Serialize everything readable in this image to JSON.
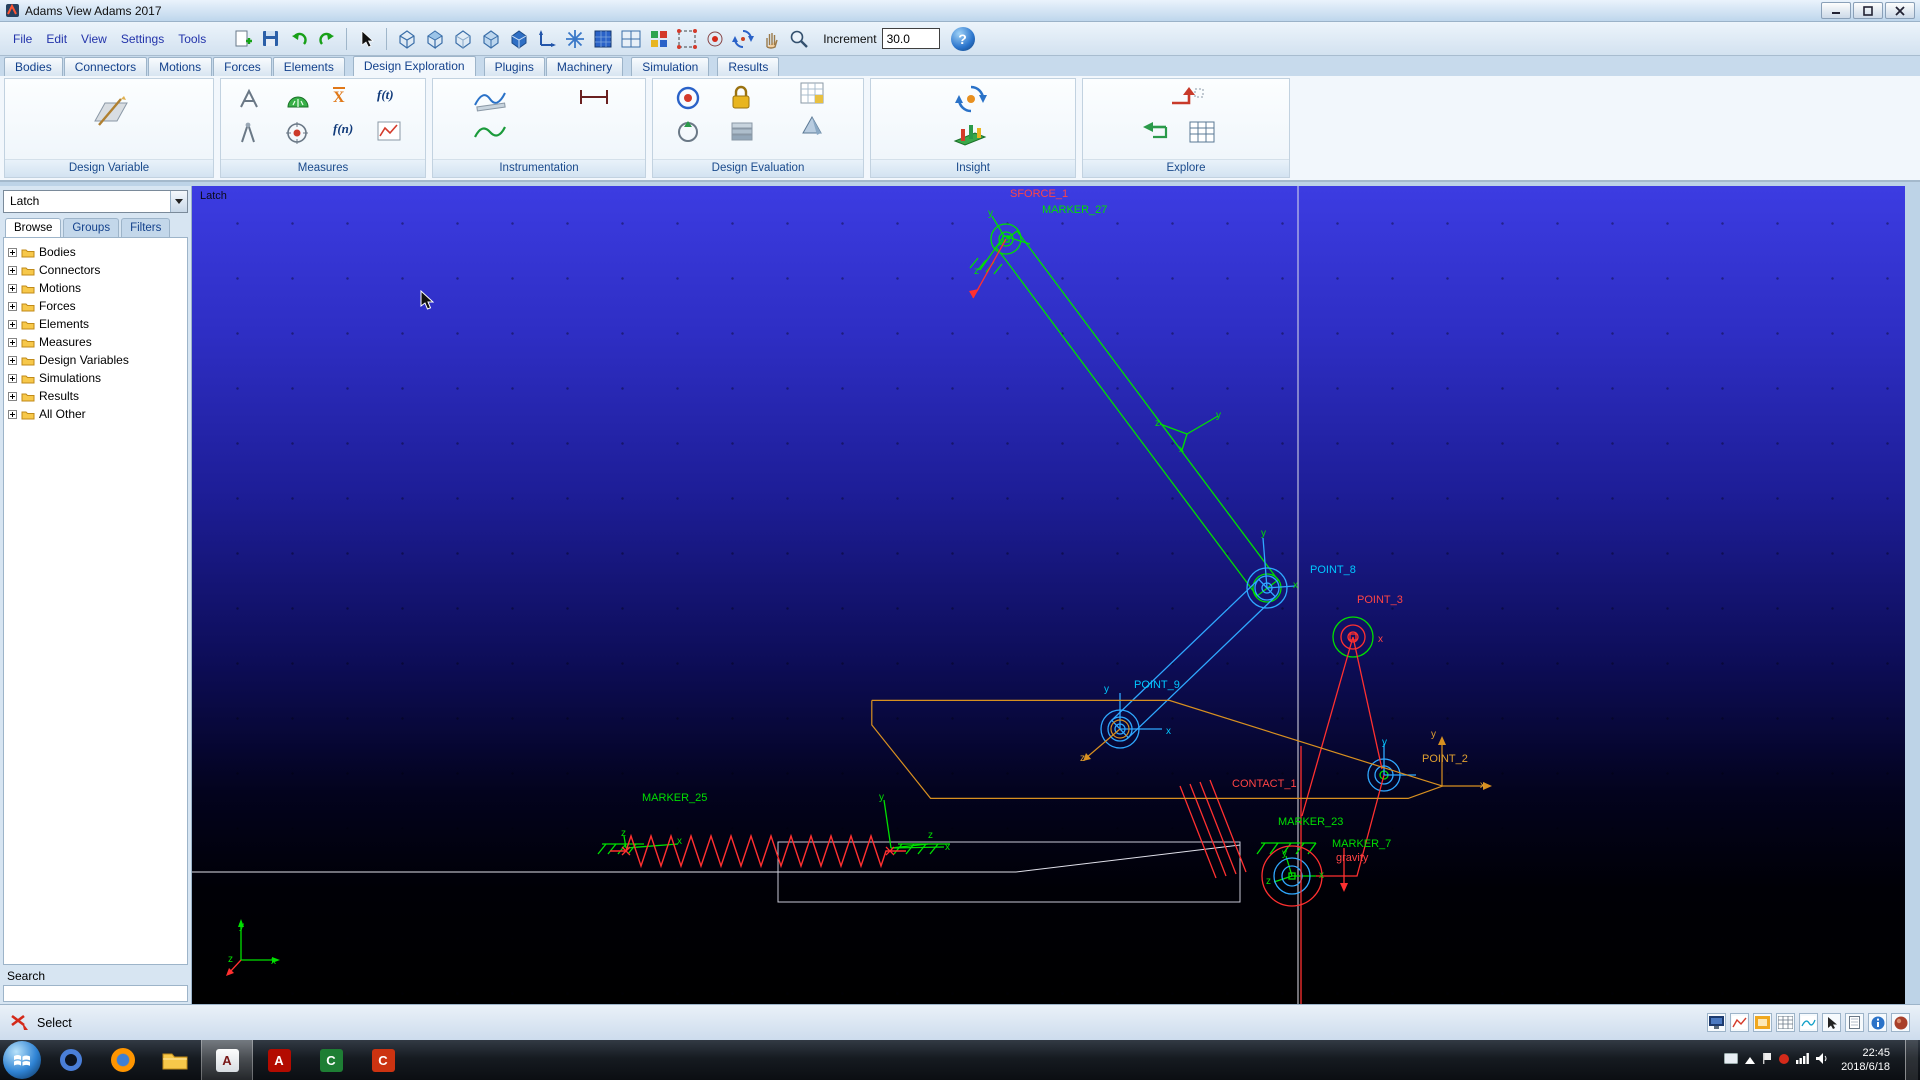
{
  "window": {
    "title": "Adams View Adams 2017"
  },
  "menubar": {
    "items": [
      "File",
      "Edit",
      "View",
      "Settings",
      "Tools"
    ]
  },
  "toolbar": {
    "increment_label": "Increment",
    "increment_value": "30.0",
    "help_glyph": "?"
  },
  "ribbon": {
    "tabs": [
      "Bodies",
      "Connectors",
      "Motions",
      "Forces",
      "Elements",
      "Design Exploration",
      "Plugins",
      "Machinery",
      "Simulation",
      "Results"
    ],
    "active_tab": "Design Exploration",
    "groups": [
      {
        "label": "Design Variable"
      },
      {
        "label": "Measures",
        "xbar": "X",
        "ft": "f(t)",
        "fn": "f(n)"
      },
      {
        "label": "Instrumentation"
      },
      {
        "label": "Design Evaluation"
      },
      {
        "label": "Insight"
      },
      {
        "label": "Explore"
      }
    ]
  },
  "sidebar": {
    "model_value": "Latch",
    "tabs": [
      "Browse",
      "Groups",
      "Filters"
    ],
    "active_tab": "Browse",
    "tree": [
      "Bodies",
      "Connectors",
      "Motions",
      "Forces",
      "Elements",
      "Measures",
      "Design Variables",
      "Simulations",
      "Results",
      "All Other"
    ],
    "search_label": "Search"
  },
  "viewport": {
    "corner_label": "Latch",
    "labels": [
      {
        "text": "SFORCE_1",
        "color": "#ff4444"
      },
      {
        "text": "MARKER_27",
        "color": "#00e000"
      },
      {
        "text": "POINT_8",
        "color": "#00c8ff"
      },
      {
        "text": "POINT_3",
        "color": "#ff4444"
      },
      {
        "text": "POINT_9",
        "color": "#00c8ff"
      },
      {
        "text": "POINT_2",
        "color": "#e0a030"
      },
      {
        "text": "MARKER_25",
        "color": "#00e000"
      },
      {
        "text": "CONTACT_1",
        "color": "#ff4444"
      },
      {
        "text": "MARKER_23",
        "color": "#00e000"
      },
      {
        "text": "MARKER_7",
        "color": "#00e000"
      },
      {
        "text": "gravity",
        "color": "#ff4444"
      },
      {
        "text": "y",
        "color": "#00e000"
      },
      {
        "text": "x",
        "color": "#00e000"
      },
      {
        "text": "z",
        "color": "#00e000"
      },
      {
        "text": "y",
        "color": "#00e000"
      },
      {
        "text": "x",
        "color": "#00e000"
      },
      {
        "text": "z",
        "color": "#00e000"
      },
      {
        "text": "y",
        "color": "#00e000"
      },
      {
        "text": "x",
        "color": "#00e000"
      },
      {
        "text": "y",
        "color": "#00c8ff"
      },
      {
        "text": "x",
        "color": "#00c8ff"
      },
      {
        "text": "z",
        "color": "#e0a030"
      },
      {
        "text": "y",
        "color": "#00c8ff"
      },
      {
        "text": "x",
        "color": "#ff4444"
      },
      {
        "text": "y",
        "color": "#00e000"
      },
      {
        "text": "x",
        "color": "#00e000"
      },
      {
        "text": "z",
        "color": "#00e000"
      },
      {
        "text": "z",
        "color": "#00e000"
      },
      {
        "text": "x",
        "color": "#00e000"
      },
      {
        "text": "y",
        "color": "#00e000"
      },
      {
        "text": "z",
        "color": "#00e000"
      },
      {
        "text": "x",
        "color": "#00e000"
      },
      {
        "text": "y",
        "color": "#e0a030"
      },
      {
        "text": "x",
        "color": "#e0a030"
      },
      {
        "text": "z",
        "color": "#00e000"
      },
      {
        "text": "y",
        "color": "#00e000"
      }
    ]
  },
  "statusbar": {
    "select_label": "Select"
  },
  "taskbar": {
    "apps": [
      {
        "glyph": ""
      },
      {
        "glyph": ""
      },
      {
        "glyph": ""
      },
      {
        "glyph": "A"
      },
      {
        "glyph": "A"
      },
      {
        "glyph": "C"
      },
      {
        "glyph": "C"
      }
    ],
    "time": "22:45",
    "date": "2018/6/18"
  },
  "colors": {
    "viewport_top": "#3c3ce2",
    "viewport_bottom": "#000000",
    "green": "#00e000",
    "cyan": "#00c8ff",
    "link_blue": "#2fa8ff",
    "red": "#ff3030",
    "orange": "#d89020",
    "white_line": "#e0e0ea",
    "accent_blue": "#13418c"
  }
}
